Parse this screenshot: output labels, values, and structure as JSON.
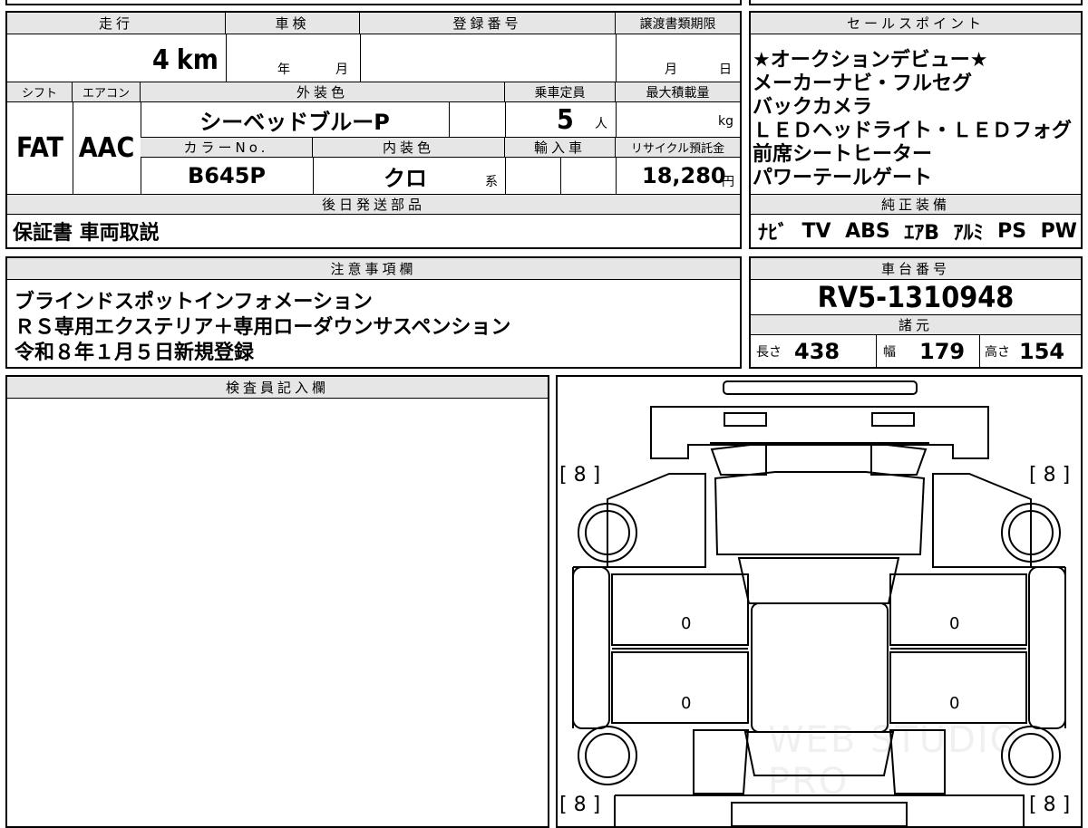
{
  "top_strip": {
    "chars": "■■ ■"
  },
  "mileage": {
    "header": "走行",
    "value": "4",
    "unit": "km"
  },
  "shaken": {
    "header": "車検",
    "year_unit": "年",
    "month_unit": "月"
  },
  "registration": {
    "header": "登録番号",
    "value": ""
  },
  "transfer_deadline": {
    "header": "譲渡書類期限",
    "month_unit": "月",
    "day_unit": "日"
  },
  "shift": {
    "header": "シフト",
    "value": "FAT"
  },
  "aircon": {
    "header": "エアコン",
    "value": "AAC"
  },
  "exterior_color": {
    "header": "外装色",
    "value": "シーベッドブルーP"
  },
  "capacity": {
    "header": "乗車定員",
    "value": "5",
    "unit": "人"
  },
  "max_load": {
    "header": "最大積載量",
    "unit": "kg"
  },
  "color_no": {
    "header": "カラーNo.",
    "value": "B645P"
  },
  "interior_color": {
    "header": "内装色",
    "value": "クロ",
    "unit": "系"
  },
  "import": {
    "header": "輸入車"
  },
  "recycle": {
    "header": "リサイクル預託金",
    "value": "18,280",
    "unit": "円"
  },
  "later_parts": {
    "header": "後日発送部品",
    "value": "保証書 車両取説"
  },
  "notes": {
    "header": "注意事項欄",
    "lines": [
      "ブラインドスポットインフォメーション",
      "ＲＳ専用エクステリア＋専用ローダウンサスペンション",
      "令和８年１月５日新規登録"
    ]
  },
  "sales_points": {
    "header": "セールスポイント",
    "lines": [
      "★オークションデビュー★",
      "メーカーナビ・フルセグ",
      "バックカメラ",
      "ＬＥＤヘッドライト・ＬＥＤフォグ",
      "前席シートヒーター",
      "パワーテールゲート"
    ]
  },
  "genuine_equipment": {
    "header": "純正装備",
    "items": [
      "ﾅﾋﾞ",
      "TV",
      "ABS",
      "ｴｱB",
      "ｱﾙﾐ",
      "PS",
      "PW"
    ]
  },
  "chassis": {
    "header": "車台番号",
    "value": "RV5-1310948"
  },
  "specs": {
    "header": "諸元",
    "length_label": "長さ",
    "length": "438",
    "width_label": "幅",
    "width": "179",
    "height_label": "高さ",
    "height": "154"
  },
  "inspector": {
    "header": "検査員記入欄"
  },
  "diagram": {
    "tire_fl": "[ 8 ]",
    "tire_fr": "[ 8 ]",
    "tire_rl": "[ 8 ]",
    "tire_rr": "[ 8 ]",
    "door_fl": "0",
    "door_rl": "0",
    "door_fr": "0",
    "door_rr": "0",
    "watermark": "WEB STUDIO PRO"
  },
  "colors": {
    "header_bg": "#e6e6e6",
    "border": "#000000"
  }
}
